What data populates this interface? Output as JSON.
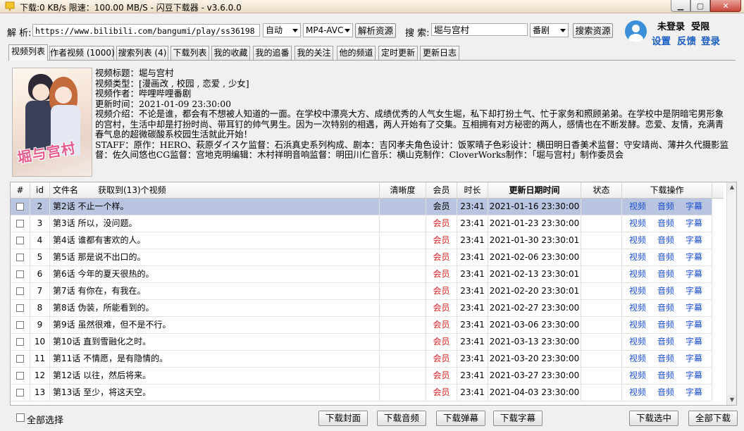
{
  "window": {
    "title": "下载:0 KB/s  限速：100.00 MB/S  - 闪豆下载器 - v3.6.0.0",
    "icons": [
      "app-icon",
      "minimize-icon",
      "maximize-icon",
      "close-icon"
    ]
  },
  "parse": {
    "label": "解 析:",
    "url": "https://www.bilibili.com/bangumi/play/ss36198",
    "quality": "自动",
    "format": "MP4-AVC",
    "button": "解析资源"
  },
  "search": {
    "label": "搜 索:",
    "query": "堀与宫村",
    "type": "番剧",
    "button": "搜索资源"
  },
  "user": {
    "login_status": "未登录",
    "restriction": "受限",
    "settings": "设置",
    "feedback": "反馈",
    "login": "登录",
    "avatar_icon": "user-avatar-icon"
  },
  "tabs": [
    {
      "label": "视频列表",
      "active": true
    },
    {
      "label": "作者视频 (1000)"
    },
    {
      "label": "搜索列表 (4)"
    },
    {
      "label": "下载列表"
    },
    {
      "label": "我的收藏"
    },
    {
      "label": "我的追番"
    },
    {
      "label": "我的关注"
    },
    {
      "label": "他的频道"
    },
    {
      "label": "定时更新"
    },
    {
      "label": "更新日志"
    }
  ],
  "video": {
    "title_line": "视频标题：堀与宫村",
    "type_line": "视频类型：[漫画改 , 校园 , 恋爱 , 少女]",
    "author_line": "视频作者：哔哩哔哩番剧",
    "time_line": "更新时间：2021-01-09 23:30:00",
    "intro": "视频介绍：不论是谁，都会有不想被人知道的一面。在学校中漂亮大方、成绩优秀的人气女生堀，私下却打扮土气、忙于家务和照顾弟弟。在学校中是阴暗宅男形象的宫村，生活中却是打扮时尚、带耳钉的帅气男生。因为一次特别的相遇，两人开始有了交集。互相拥有对方秘密的两人，感情也在不断发酵。恋爱、友情，充满青春气息的超微碳酸系校园生活就此开始！",
    "staff": "STAFF：原作：HERO、萩原ダイスケ监督：石浜真史系列构成、剧本：吉冈孝夫角色设计：饭冢晴子色彩设计：横田明日香美术监督：守安靖尚、薄井久代摄影监督：佐久间悠也CG监督：宫地克明编辑：木村祥明音响监督：明田川仁音乐：横山克制作：CloverWorks制作：「堀与宫村」制作委员会",
    "cover_logo": "堀与宫村"
  },
  "table": {
    "headers": [
      "#",
      "id",
      "文件名",
      "获取到(13)个视频",
      "清晰度",
      "会员",
      "时长",
      "更新日期时间",
      "状态",
      "下载操作"
    ],
    "actions": [
      "视频",
      "音频",
      "字幕"
    ],
    "rows": [
      {
        "id": "2",
        "name": "第2话 不止一个样。",
        "member": "会员",
        "duration": "23:41",
        "date": "2021-01-16 23:30:00",
        "selected": true
      },
      {
        "id": "3",
        "name": "第3话 所以，没问题。",
        "member": "会员",
        "duration": "23:41",
        "date": "2021-01-23 23:30:00"
      },
      {
        "id": "4",
        "name": "第4话 谁都有害欢的人。",
        "member": "会员",
        "duration": "23:41",
        "date": "2021-01-30 23:30:01"
      },
      {
        "id": "5",
        "name": "第5话 那是说不出口的。",
        "member": "会员",
        "duration": "23:41",
        "date": "2021-02-06 23:30:00"
      },
      {
        "id": "6",
        "name": "第6话 今年的夏天很热的。",
        "member": "会员",
        "duration": "23:41",
        "date": "2021-02-13 23:30:01"
      },
      {
        "id": "7",
        "name": "第7话 有你在，有我在。",
        "member": "会员",
        "duration": "23:41",
        "date": "2021-02-20 23:30:01"
      },
      {
        "id": "8",
        "name": "第8话 伪装，所能看到的。",
        "member": "会员",
        "duration": "23:41",
        "date": "2021-02-27 23:30:00"
      },
      {
        "id": "9",
        "name": "第9话 虽然很难，但不是不行。",
        "member": "会员",
        "duration": "23:41",
        "date": "2021-03-06 23:30:00"
      },
      {
        "id": "10",
        "name": "第10话 直到雪融化之时。",
        "member": "会员",
        "duration": "23:41",
        "date": "2021-03-13 23:30:00"
      },
      {
        "id": "11",
        "name": "第11话 不情愿，是有隐情的。",
        "member": "会员",
        "duration": "23:41",
        "date": "2021-03-20 23:30:00"
      },
      {
        "id": "12",
        "name": "第12话 以往，然后将来。",
        "member": "会员",
        "duration": "23:41",
        "date": "2021-03-27 23:30:00"
      },
      {
        "id": "13",
        "name": "第13话 至少，将这天空。",
        "member": "会员",
        "duration": "23:41",
        "date": "2021-04-03 23:30:00"
      }
    ]
  },
  "bottom": {
    "select_all": "全部选择",
    "download_cover": "下载封面",
    "download_audio": "下载音频",
    "download_danmaku": "下载弹幕",
    "download_subtitle": "下载字幕",
    "download_selected": "下载选中",
    "download_all": "全部下载"
  }
}
